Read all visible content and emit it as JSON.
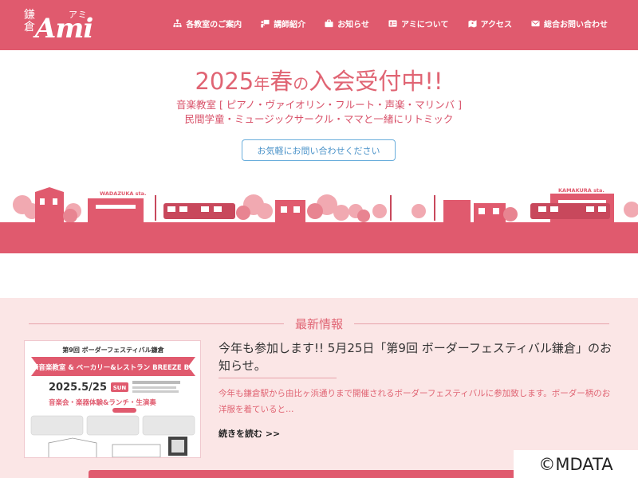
{
  "header": {
    "logo": {
      "kanji": "鎌倉",
      "kana": "アミ",
      "name": "Ami"
    },
    "nav": [
      {
        "label": "各教室のご案内",
        "icon": "sitemap-icon"
      },
      {
        "label": "講師紹介",
        "icon": "teacher-icon"
      },
      {
        "label": "お知らせ",
        "icon": "briefcase-icon"
      },
      {
        "label": "アミについて",
        "icon": "id-card-icon"
      },
      {
        "label": "アクセス",
        "icon": "map-icon"
      },
      {
        "label": "総合お問い合わせ",
        "icon": "envelope-icon"
      }
    ]
  },
  "hero": {
    "title_year": "2025",
    "title_nen": "年",
    "title_spring": "春",
    "title_no": "の",
    "title_main": "入会受付中!!",
    "line1": "音楽教室 [ ピアノ・ヴァイオリン・フルート・声楽・マリンバ ]",
    "line2": "民間学童・ミュージックサークル・ママと一緒にリトミック",
    "cta": "お気軽にお問い合わせください",
    "stations": {
      "left": "WADAZUKA sta.",
      "right": "KAMAKURA sta."
    }
  },
  "news": {
    "heading": "最新情報",
    "card": {
      "image": {
        "event": "第9回 ボーダーフェスティバル鎌倉",
        "banner": "Ami音楽教室 & ベーカリー&レストラン BREEZE BIRD",
        "date": "2025.5/25",
        "weekday": "SUN",
        "program": "音楽会・楽器体験&ランチ・生演奏"
      },
      "title": "今年も参加します!! 5月25日「第9回 ボーダーフェスティバル鎌倉」のお知らせ。",
      "excerpt": "今年も鎌倉駅から由比ヶ浜通りまで開催されるボーダーフェスティバルに参加致します。ボーダー柄のお洋服を着ていると…",
      "read_more": "続きを読む >>"
    }
  },
  "watermark": "©MDATA",
  "colors": {
    "brand": "#e05a6e",
    "pink_light": "#fbe6e6",
    "cta_blue": "#4b93c9"
  }
}
